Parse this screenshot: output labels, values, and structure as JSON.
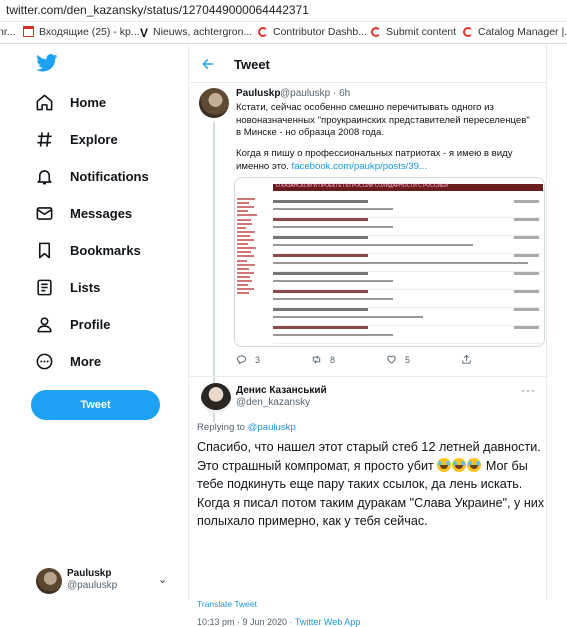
{
  "browser": {
    "url": "twitter.com/den_kazansky/status/1270449000064442371",
    "bookmarks": [
      {
        "label": "nr...",
        "icon": "partial-icon"
      },
      {
        "label": "Входящие (25) - kp...",
        "icon": "gmail-icon"
      },
      {
        "label": "Nieuws, achtergron...",
        "icon": "v-icon"
      },
      {
        "label": "Contributor Dashb...",
        "icon": "shutterstock-icon"
      },
      {
        "label": "Submit content",
        "icon": "shutterstock-icon"
      },
      {
        "label": "Catalog Manager |...",
        "icon": "shutterstock-icon"
      }
    ]
  },
  "sidebar": {
    "nav": [
      {
        "label": "Home",
        "icon": "home-icon"
      },
      {
        "label": "Explore",
        "icon": "hashtag-icon"
      },
      {
        "label": "Notifications",
        "icon": "bell-icon"
      },
      {
        "label": "Messages",
        "icon": "envelope-icon"
      },
      {
        "label": "Bookmarks",
        "icon": "bookmark-icon"
      },
      {
        "label": "Lists",
        "icon": "list-icon"
      },
      {
        "label": "Profile",
        "icon": "person-icon"
      },
      {
        "label": "More",
        "icon": "more-circle-icon"
      }
    ],
    "tweet_button": "Tweet",
    "account": {
      "name": "Pauluskp",
      "handle": "@pauluskp"
    }
  },
  "header": {
    "title": "Tweet"
  },
  "parent_tweet": {
    "name": "Pauluskp",
    "handle_time": "@pauluskp · 6h",
    "text": "Кстати, сейчас особенно смешно перечитывать одного из новоназначенных \"проукраинских представителей переселенцев\" в Минске - но образца 2008 года.",
    "text2": "Когда я пишу о профессиональных патриотах - я имею в виду именно это.",
    "link": "facebook.com/paukp/posts/39...",
    "embed_banner": "О КАЗАНСКОМ И ПРОЕКТЕ ПО РОССИИ СОЛИДАРНОСТИ С РОССИЕЙ",
    "counts": {
      "reply": "3",
      "retweet": "8",
      "like": "5"
    }
  },
  "reply_tweet": {
    "name": "Денис Казанський",
    "handle": "@den_kazansky",
    "replying_prefix": "Replying to",
    "replying_to": "@pauluskp",
    "body_1": "Спасибо, что нашел этот старый стеб 12 летней давности. Это страшный компромат, я просто убит",
    "body_2": "Мог бы тебе подкинуть еще пару таких ссылок, да лень искать. Когда я писал потом таким дуракам \"Слава Украине\", у них полыхало примерно, как у тебя сейчас.",
    "translate": "Translate Tweet",
    "timestamp": "10:13 pm · 9 Jun 2020 ·",
    "source": "Twitter Web App"
  },
  "colors": {
    "accent": "#1da1f2",
    "link": "#1b95e0",
    "muted": "#536471"
  }
}
